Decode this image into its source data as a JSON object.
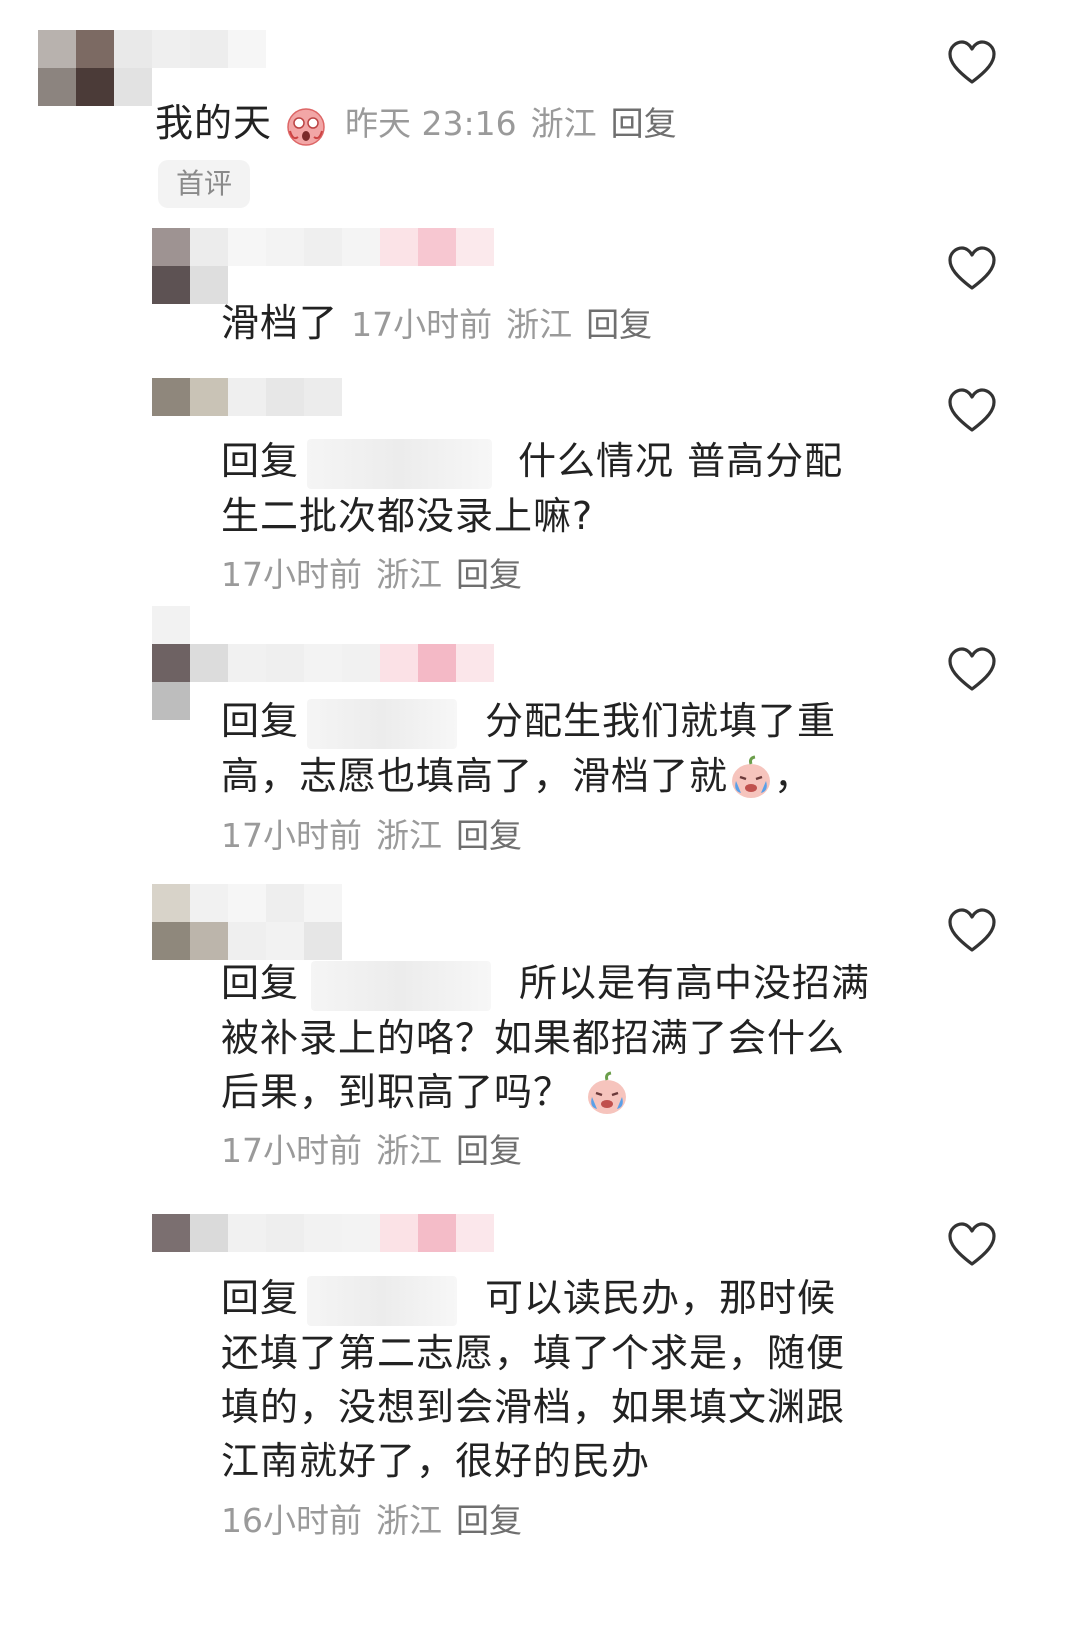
{
  "colors": {
    "text": "#222222",
    "meta": "#9a9a9a",
    "heart_stroke": "#333333",
    "badge_bg": "#f3f3f3"
  },
  "top_comment": {
    "text": "我的天",
    "emoji": "scream-emoji",
    "time": "昨天 23:16",
    "location": "浙江",
    "reply_label": "回复",
    "badge": "首评"
  },
  "replies": [
    {
      "prefix": "",
      "text": "滑档了",
      "time": "17小时前",
      "location": "浙江",
      "reply_label": "回复"
    },
    {
      "prefix": "回复",
      "line1": "什么情况 普高分配",
      "line2": "生二批次都没录上嘛?",
      "time": "17小时前",
      "location": "浙江",
      "reply_label": "回复"
    },
    {
      "prefix": "回复",
      "line1": "分配生我们就填了重",
      "line2": "高，志愿也填高了，滑档了就",
      "line2_tail": "，",
      "time": "17小时前",
      "location": "浙江",
      "reply_label": "回复"
    },
    {
      "prefix": "回复",
      "line1": "所以是有高中没招满",
      "line2": "被补录上的咯？如果都招满了会什么",
      "line3": "后果，到职高了吗？",
      "time": "17小时前",
      "location": "浙江",
      "reply_label": "回复"
    },
    {
      "prefix": "回复",
      "line1": "可以读民办，那时候",
      "line2": "还填了第二志愿，填了个求是，随便",
      "line3": "填的，没想到会滑档，如果填文渊跟",
      "line4": "江南就好了，很好的民办",
      "time": "16小时前",
      "location": "浙江",
      "reply_label": "回复"
    }
  ]
}
